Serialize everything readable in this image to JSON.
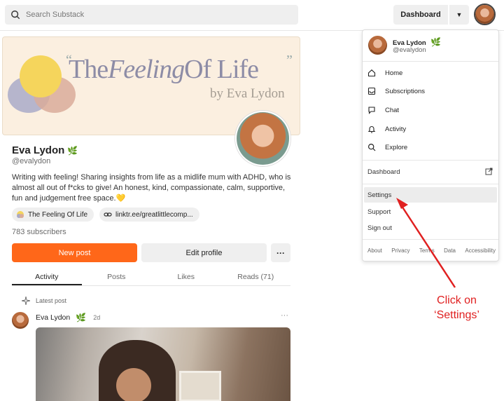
{
  "search": {
    "placeholder": "Search Substack",
    "icon": "search-icon"
  },
  "header": {
    "dashboard_label": "Dashboard",
    "caret": "▼"
  },
  "banner": {
    "title_part1": "The",
    "title_part2": "Feeling",
    "title_part3": "Of Life",
    "subtitle": "by Eva Lydon",
    "quote_open": "“",
    "quote_close": "”"
  },
  "profile": {
    "name": "Eva Lydon",
    "badge": "🌿",
    "handle": "@evalydon",
    "bio": "Writing with feeling! Sharing insights from life as a midlife mum with ADHD, who is almost all out of f*cks to give! An honest, kind, compassionate, calm, supportive, fun and judgement free space.💛",
    "chips": [
      {
        "label": "The Feeling Of Life",
        "icon": "publication-icon"
      },
      {
        "label": "linktr.ee/greatlittlecomp...",
        "icon": "link-icon"
      }
    ],
    "subscribers": "783 subscribers",
    "new_post_label": "New post",
    "edit_profile_label": "Edit profile",
    "more_label": "···"
  },
  "tabs": [
    {
      "label": "Activity",
      "active": true
    },
    {
      "label": "Posts",
      "active": false
    },
    {
      "label": "Likes",
      "active": false
    },
    {
      "label": "Reads (71)",
      "active": false
    }
  ],
  "feed": {
    "latest_label": "Latest post",
    "author": "Eva Lydon",
    "badge": "🌿",
    "time": "2d",
    "more": "···"
  },
  "dropdown": {
    "user_name": "Eva Lydon",
    "user_badge": "🌿",
    "user_handle": "@evalydon",
    "nav": [
      {
        "label": "Home",
        "icon": "home-icon"
      },
      {
        "label": "Subscriptions",
        "icon": "inbox-icon"
      },
      {
        "label": "Chat",
        "icon": "chat-icon"
      },
      {
        "label": "Activity",
        "icon": "bell-icon"
      },
      {
        "label": "Explore",
        "icon": "search-icon"
      }
    ],
    "dashboard_label": "Dashboard",
    "settings_label": "Settings",
    "support_label": "Support",
    "signout_label": "Sign out",
    "footer": [
      "About",
      "Privacy",
      "Terms",
      "Data",
      "Accessibility"
    ]
  },
  "annotation": {
    "line1": "Click on",
    "line2": "‘Settings’",
    "color": "#e02020"
  },
  "colors": {
    "accent": "#ff6719"
  }
}
